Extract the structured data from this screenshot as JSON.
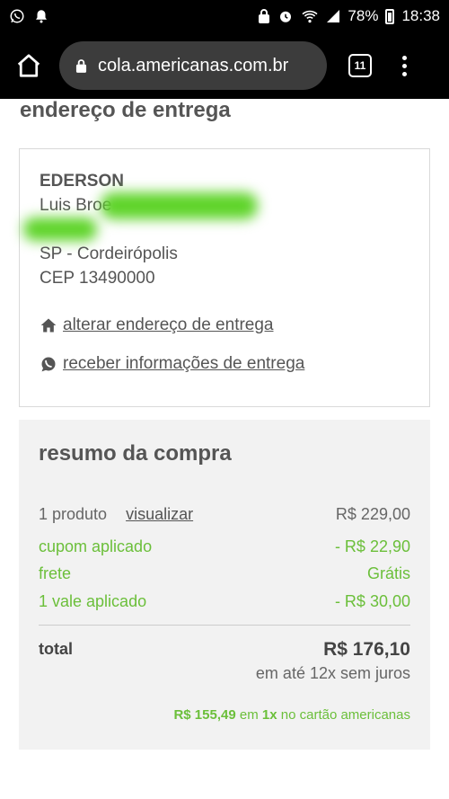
{
  "status_bar": {
    "battery": "78%",
    "time": "18:38"
  },
  "browser": {
    "url": "cola.americanas.com.br",
    "tab_count": "11"
  },
  "delivery": {
    "title": "endereço de entrega",
    "name": "EDERSON",
    "street_partial": "Luis Broe",
    "city_state": "SP - Cordeirópolis",
    "cep": "CEP 13490000",
    "change_address_link": "alterar endereço de entrega",
    "delivery_info_link": "receber informações de entrega"
  },
  "summary": {
    "title": "resumo da compra",
    "product_count": "1 produto",
    "view_link": "visualizar",
    "product_price": "R$ 229,00",
    "coupon_label": "cupom aplicado",
    "coupon_value": "- R$ 22,90",
    "shipping_label": "frete",
    "shipping_value": "Grátis",
    "voucher_label": "1 vale aplicado",
    "voucher_value": "- R$ 30,00",
    "total_label": "total",
    "total_value": "R$ 176,10",
    "installments": "em até 12x sem juros",
    "card_offer": {
      "price": "R$ 155,49",
      "em": "em",
      "times": "1x",
      "suffix": "no cartão americanas"
    }
  },
  "colors": {
    "accent_green": "#6bbf3a",
    "text": "#555555",
    "panel": "#f2f2f2"
  }
}
